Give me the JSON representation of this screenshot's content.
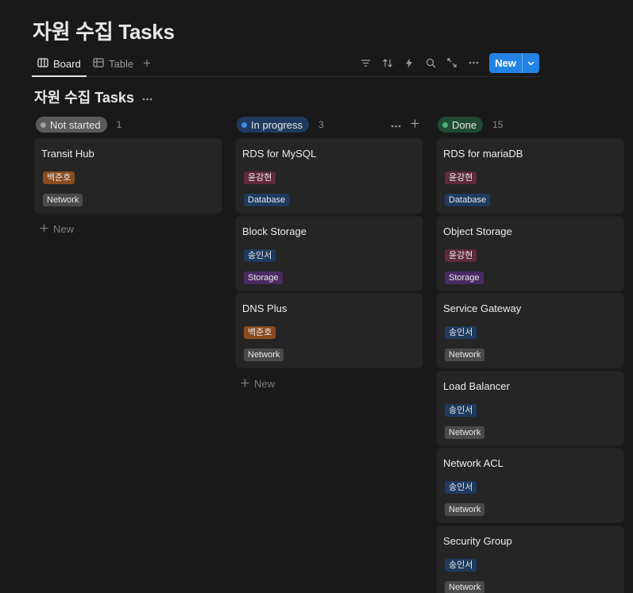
{
  "title": "자원 수집 Tasks",
  "views": {
    "board": "Board",
    "table": "Table",
    "add": "+"
  },
  "toolbar": {
    "new_label": "New",
    "icons": [
      "filter-icon",
      "sort-icon",
      "automation-icon",
      "search-icon",
      "expand-icon",
      "more-icon"
    ]
  },
  "section": {
    "title": "자원 수집 Tasks",
    "more": "···"
  },
  "columns": [
    {
      "status": "Not started",
      "count": "1",
      "pill_color": "#5a5a5a",
      "dot_color": "#a0a0a0",
      "cards": [
        {
          "title": "Transit Hub",
          "person": "백준호",
          "person_color": "#8a4b1f",
          "category": "Network",
          "category_color": "#4a4a4a"
        }
      ],
      "add_label": "New"
    },
    {
      "status": "In progress",
      "count": "3",
      "pill_color": "#1f3a5e",
      "dot_color": "#3c8ee8",
      "cards": [
        {
          "title": "RDS for MySQL",
          "person": "윤강현",
          "person_color": "#5e2a3c",
          "category": "Database",
          "category_color": "#1f3a5e"
        },
        {
          "title": "Block Storage",
          "person": "송인서",
          "person_color": "#1f3a5e",
          "category": "Storage",
          "category_color": "#4a2a62"
        },
        {
          "title": "DNS Plus",
          "person": "백준호",
          "person_color": "#8a4b1f",
          "category": "Network",
          "category_color": "#4a4a4a"
        }
      ],
      "add_label": "New"
    },
    {
      "status": "Done",
      "count": "15",
      "pill_color": "#1f4a33",
      "dot_color": "#4bb37a",
      "cards": [
        {
          "title": "RDS for mariaDB",
          "person": "윤강현",
          "person_color": "#5e2a3c",
          "category": "Database",
          "category_color": "#1f3a5e"
        },
        {
          "title": "Object Storage",
          "person": "윤강현",
          "person_color": "#5e2a3c",
          "category": "Storage",
          "category_color": "#4a2a62"
        },
        {
          "title": "Service Gateway",
          "person": "송인서",
          "person_color": "#1f3a5e",
          "category": "Network",
          "category_color": "#4a4a4a"
        },
        {
          "title": "Load Balancer",
          "person": "송인서",
          "person_color": "#1f3a5e",
          "category": "Network",
          "category_color": "#4a4a4a"
        },
        {
          "title": "Network ACL",
          "person": "송인서",
          "person_color": "#1f3a5e",
          "category": "Network",
          "category_color": "#4a4a4a"
        },
        {
          "title": "Security Group",
          "person": "송인서",
          "person_color": "#1f3a5e",
          "category": "Network",
          "category_color": "#4a4a4a"
        }
      ]
    }
  ]
}
